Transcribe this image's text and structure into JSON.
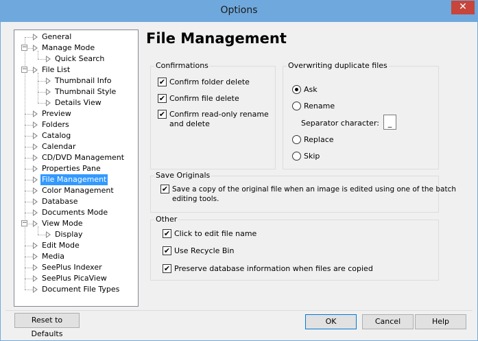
{
  "window": {
    "title": "Options",
    "close_symbol": "✕",
    "accent_color": "#6fa8dc",
    "close_color": "#c7453a"
  },
  "tree": {
    "items": [
      {
        "label": "General",
        "level": 0,
        "expander": "",
        "selected": false
      },
      {
        "label": "Manage Mode",
        "level": 0,
        "expander": "−",
        "selected": false
      },
      {
        "label": "Quick Search",
        "level": 1,
        "expander": "",
        "selected": false
      },
      {
        "label": "File List",
        "level": 0,
        "expander": "−",
        "selected": false
      },
      {
        "label": "Thumbnail Info",
        "level": 1,
        "expander": "",
        "selected": false
      },
      {
        "label": "Thumbnail Style",
        "level": 1,
        "expander": "",
        "selected": false
      },
      {
        "label": "Details View",
        "level": 1,
        "expander": "",
        "selected": false
      },
      {
        "label": "Preview",
        "level": 0,
        "expander": "",
        "selected": false
      },
      {
        "label": "Folders",
        "level": 0,
        "expander": "",
        "selected": false
      },
      {
        "label": "Catalog",
        "level": 0,
        "expander": "",
        "selected": false
      },
      {
        "label": "Calendar",
        "level": 0,
        "expander": "",
        "selected": false
      },
      {
        "label": "CD/DVD Management",
        "level": 0,
        "expander": "",
        "selected": false
      },
      {
        "label": "Properties Pane",
        "level": 0,
        "expander": "",
        "selected": false
      },
      {
        "label": "File Management",
        "level": 0,
        "expander": "",
        "selected": true
      },
      {
        "label": "Color Management",
        "level": 0,
        "expander": "",
        "selected": false
      },
      {
        "label": "Database",
        "level": 0,
        "expander": "",
        "selected": false
      },
      {
        "label": "Documents Mode",
        "level": 0,
        "expander": "",
        "selected": false
      },
      {
        "label": "View Mode",
        "level": 0,
        "expander": "−",
        "selected": false
      },
      {
        "label": "Display",
        "level": 1,
        "expander": "",
        "selected": false
      },
      {
        "label": "Edit Mode",
        "level": 0,
        "expander": "",
        "selected": false
      },
      {
        "label": "Media",
        "level": 0,
        "expander": "",
        "selected": false
      },
      {
        "label": "SeePlus Indexer",
        "level": 0,
        "expander": "",
        "selected": false
      },
      {
        "label": "SeePlus PicaView",
        "level": 0,
        "expander": "",
        "selected": false
      },
      {
        "label": "Document File Types",
        "level": 0,
        "expander": "",
        "selected": false
      }
    ],
    "selected_color": "#3399ff"
  },
  "panel": {
    "title": "File Management",
    "confirmations": {
      "label": "Confirmations",
      "items": [
        {
          "label": "Confirm folder delete",
          "checked": true
        },
        {
          "label": "Confirm file delete",
          "checked": true
        },
        {
          "label": "Confirm read-only rename",
          "label2": "and delete",
          "checked": true
        }
      ]
    },
    "overwriting": {
      "label": "Overwriting duplicate files",
      "options": [
        {
          "label": "Ask",
          "selected": true
        },
        {
          "label": "Rename",
          "selected": false
        },
        {
          "label": "Replace",
          "selected": false
        },
        {
          "label": "Skip",
          "selected": false
        }
      ],
      "separator_label": "Separator character:",
      "separator_value": "_"
    },
    "save_originals": {
      "label": "Save Originals",
      "checkbox_line1": "Save a copy of the original file when an image is edited using one of the batch",
      "checkbox_line2": "editing tools.",
      "checked": true
    },
    "other": {
      "label": "Other",
      "items": [
        {
          "label": "Click to edit file name",
          "checked": true
        },
        {
          "label": "Use Recycle Bin",
          "checked": true
        },
        {
          "label": "Preserve database information when files are copied",
          "checked": true
        }
      ]
    }
  },
  "buttons": {
    "reset": "Reset to Defaults",
    "ok": "OK",
    "cancel": "Cancel",
    "help": "Help"
  },
  "checkmark": "✔"
}
